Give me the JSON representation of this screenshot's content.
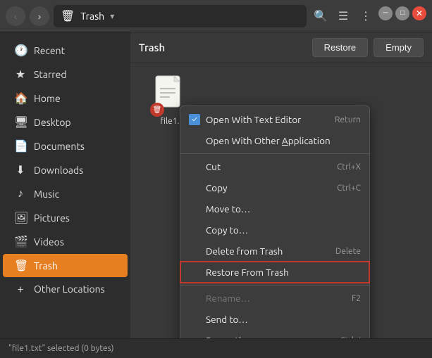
{
  "titlebar": {
    "back_label": "‹",
    "forward_label": "›",
    "location": "Trash",
    "dropdown_icon": "▾",
    "search_icon": "🔍",
    "view_icon": "☰",
    "options_icon": "⋮",
    "min_icon": "─",
    "max_icon": "□",
    "close_icon": "✕"
  },
  "sidebar": {
    "items": [
      {
        "id": "recent",
        "label": "Recent",
        "icon": "🕐"
      },
      {
        "id": "starred",
        "label": "Starred",
        "icon": "★"
      },
      {
        "id": "home",
        "label": "Home",
        "icon": "🏠"
      },
      {
        "id": "desktop",
        "label": "Desktop",
        "icon": "🖥"
      },
      {
        "id": "documents",
        "label": "Documents",
        "icon": "📄"
      },
      {
        "id": "downloads",
        "label": "Downloads",
        "icon": "⬇"
      },
      {
        "id": "music",
        "label": "Music",
        "icon": "♪"
      },
      {
        "id": "pictures",
        "label": "Pictures",
        "icon": "🖼"
      },
      {
        "id": "videos",
        "label": "Videos",
        "icon": "🎬"
      },
      {
        "id": "trash",
        "label": "Trash",
        "icon": "🗑",
        "active": true
      },
      {
        "id": "other",
        "label": "Other Locations",
        "icon": "+"
      }
    ]
  },
  "content": {
    "title": "Trash",
    "restore_btn": "Restore",
    "empty_btn": "Empty"
  },
  "file": {
    "name": "file1.",
    "full_name": "file1.txt"
  },
  "context_menu": {
    "items": [
      {
        "id": "open-text",
        "label": "Open With Text Editor",
        "shortcut": "Return",
        "checked": true,
        "enabled": true
      },
      {
        "id": "open-other",
        "label": "Open With Other Application",
        "shortcut": "",
        "checked": false,
        "enabled": true
      },
      {
        "id": "divider1",
        "type": "divider"
      },
      {
        "id": "cut",
        "label": "Cut",
        "shortcut": "Ctrl+X",
        "checked": false,
        "enabled": true
      },
      {
        "id": "copy",
        "label": "Copy",
        "shortcut": "Ctrl+C",
        "checked": false,
        "enabled": true
      },
      {
        "id": "move-to",
        "label": "Move to…",
        "shortcut": "",
        "checked": false,
        "enabled": true
      },
      {
        "id": "copy-to",
        "label": "Copy to…",
        "shortcut": "",
        "checked": false,
        "enabled": true
      },
      {
        "id": "delete",
        "label": "Delete from Trash",
        "shortcut": "Delete",
        "checked": false,
        "enabled": true
      },
      {
        "id": "restore",
        "label": "Restore From Trash",
        "shortcut": "",
        "checked": false,
        "enabled": true,
        "highlighted": true
      },
      {
        "id": "divider2",
        "type": "divider"
      },
      {
        "id": "rename",
        "label": "Rename…",
        "shortcut": "F2",
        "checked": false,
        "enabled": false
      },
      {
        "id": "send-to",
        "label": "Send to…",
        "shortcut": "",
        "checked": false,
        "enabled": true
      },
      {
        "id": "properties",
        "label": "Properties",
        "shortcut": "Ctrl+I",
        "checked": false,
        "enabled": true
      }
    ]
  },
  "statusbar": {
    "text": "\"file1.txt\" selected  (0 bytes)"
  }
}
